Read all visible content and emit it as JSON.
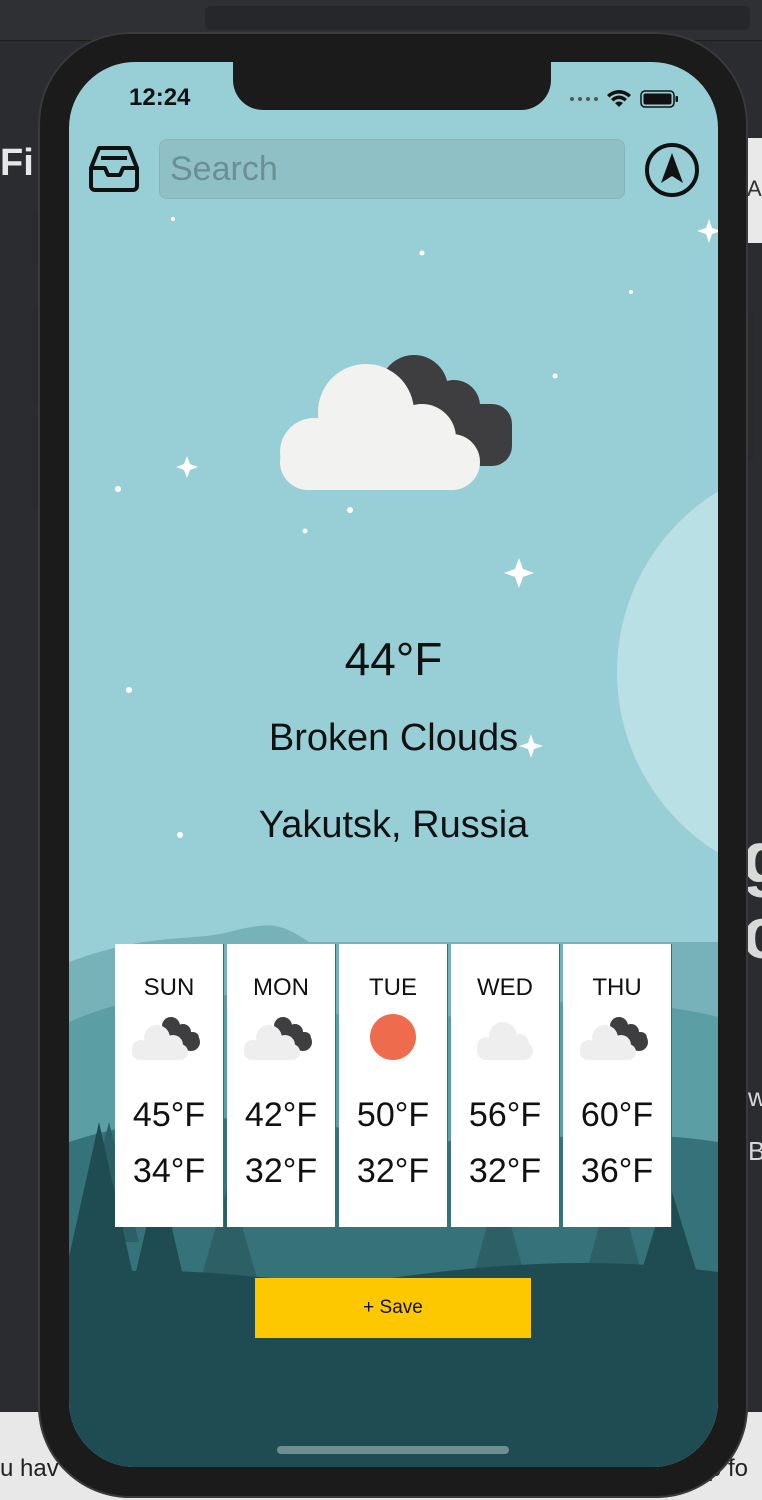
{
  "status_bar": {
    "time": "12:24"
  },
  "search": {
    "placeholder": "Search",
    "value": ""
  },
  "current": {
    "temperature": "44°F",
    "condition": "Broken Clouds",
    "location": "Yakutsk, Russia",
    "icon": "broken-clouds-icon"
  },
  "forecast": [
    {
      "day": "SUN",
      "high": "45°F",
      "low": "34°F",
      "icon": "broken-clouds-icon"
    },
    {
      "day": "MON",
      "high": "42°F",
      "low": "32°F",
      "icon": "broken-clouds-icon"
    },
    {
      "day": "TUE",
      "high": "50°F",
      "low": "32°F",
      "icon": "sun-icon"
    },
    {
      "day": "WED",
      "high": "56°F",
      "low": "32°F",
      "icon": "cloud-icon"
    },
    {
      "day": "THU",
      "high": "60°F",
      "low": "36°F",
      "icon": "broken-clouds-icon"
    }
  ],
  "actions": {
    "save_label": "+ Save"
  },
  "host": {
    "left_fragment": "Fi",
    "right_panel_fragment": "A",
    "right_big_fragment_1": "g",
    "right_big_fragment_2": "c",
    "right_small_fragment_1": "w",
    "right_small_fragment_2": "B",
    "bottom_left_fragment": "u hav",
    "bottom_right_fragment": "p fo"
  },
  "colors": {
    "sky": "#98cfd6",
    "save_button": "#fec800",
    "sun": "#ee6b4d",
    "hill_light": "#74aeb3",
    "hill_mid": "#4e8e94",
    "forest_dark": "#1e4a50"
  }
}
